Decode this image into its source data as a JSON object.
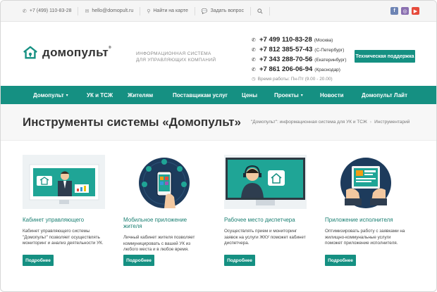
{
  "topbar": {
    "phone": "+7 (499) 110-83-28",
    "email": "hello@domopult.ru",
    "map": "Найти на карте",
    "ask": "Задать вопрос"
  },
  "brand": {
    "name": "домопульт",
    "reg": "®",
    "tagline_line1": "ИНФОРМАЦИОННАЯ СИСТЕМА",
    "tagline_line2": "ДЛЯ УПРАВЛЯЮЩИХ КОМПАНИЙ",
    "accent": "#159082"
  },
  "phones": [
    {
      "number": "+7 499 110-83-28",
      "city": "(Москва)"
    },
    {
      "number": "+7 812 385-57-43",
      "city": "(С-Петербург)"
    },
    {
      "number": "+7 343 288-70-56",
      "city": "(Екатеринбург)"
    },
    {
      "number": "+7 861 206-06-94",
      "city": "(Краснодар)"
    }
  ],
  "hours": "Время работы: Пн-Пт (9.00 - 20.00)",
  "support_label": "Техническая поддержка",
  "nav": [
    {
      "label": "Домопульт",
      "chevron": true
    },
    {
      "label": "УК и ТСЖ",
      "chevron": false
    },
    {
      "label": "Жителям",
      "chevron": false
    },
    {
      "label": "Поставщикам услуг",
      "chevron": false
    },
    {
      "label": "Цены",
      "chevron": false
    },
    {
      "label": "Проекты",
      "chevron": true
    },
    {
      "label": "Новости",
      "chevron": false
    },
    {
      "label": "Домопульт Лайт",
      "chevron": false
    }
  ],
  "page_title": "Инструменты системы «Домопульт»",
  "breadcrumb": [
    "\"Домопульт\": информационная система для УК и ТСЖ",
    "Инструментарий"
  ],
  "cards": [
    {
      "title": "Кабинет управляющего",
      "desc": "Кабинет управляющего системы \"Домопульт\" позволяет осуществлять мониторинг и анализ деятельности УК.",
      "button": "Подробнее"
    },
    {
      "title": "Мобильное приложение жителя",
      "desc": "Личный кабинет жителя позволяет коммуницировать с вашей УК из любого места и в любое время.",
      "button": "Подробнее"
    },
    {
      "title": "Рабочее место диспетчера",
      "desc": "Осуществлять прием и мониторинг заявок на услуги ЖКУ поможет кабинет диспетчера.",
      "button": "Подробнее"
    },
    {
      "title": "Приложение исполнителя",
      "desc": "Оптимизировать работу с заявками на жилищно-коммунальные услуги поможет приложение исполнителя.",
      "button": "Подробнее"
    }
  ]
}
